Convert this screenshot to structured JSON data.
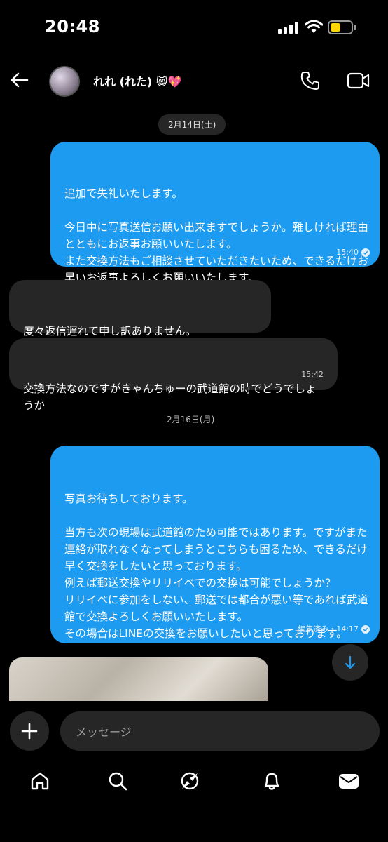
{
  "status_bar": {
    "time": "20:48",
    "battery_color": "#ffd60a"
  },
  "header": {
    "back_icon": "back-arrow-icon",
    "contact_name": "れれ (れた) 😸💖",
    "call_icon": "phone-icon",
    "video_icon": "video-camera-icon"
  },
  "messages": [
    {
      "type": "date",
      "text": "2月14日(土)"
    },
    {
      "type": "outgoing",
      "text": "追加で失礼いたします。\n\n今日中に写真送信お願い出来ますでしょうか。難しければ理由とともにお返事お願いいたします。\nまた交換方法もご相談させていただきたいため、できるだけお早いお返事よろしくお願いいたします。",
      "time": "15:40"
    },
    {
      "type": "incoming",
      "text": "度々返信遅れて申し訳ありません。\n今出先なので今日の夜に写真送信致します。"
    },
    {
      "type": "incoming",
      "text": "交換方法なのですがきゃんちゅーの武道館の時でどうでしょうか",
      "time": "15:42"
    },
    {
      "type": "date",
      "text": "2月16日(月)"
    },
    {
      "type": "outgoing",
      "text": "写真お待ちしております。\n\n当方も次の現場は武道館のため可能ではあります。ですがまた連絡が取れなくなってしまうとこちらも困るため、できるだけ早く交換をしたいと思っております。\n例えば郵送交換やリリイベでの交換は可能でしょうか？\nリリイベに参加をしない、郵送では都合が悪い等であれば武道館で交換よろしくお願いいたします。\nその場合はLINEの交換をお願いしたいと思っております。",
      "time": "編集済み・14:17"
    }
  ],
  "composer": {
    "placeholder": "メッセージ",
    "add_icon": "plus-icon"
  },
  "scroll_down_icon": "arrow-down-icon",
  "bottom_nav": [
    "home-icon",
    "search-icon",
    "explore-icon",
    "bell-icon",
    "inbox-icon"
  ],
  "colors": {
    "outgoing_bubble": "#1d9bf0",
    "incoming_bubble": "#262626",
    "background": "#000000"
  }
}
